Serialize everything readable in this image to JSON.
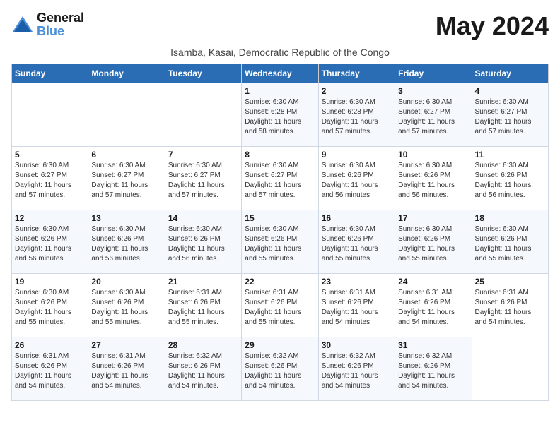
{
  "header": {
    "logo_general": "General",
    "logo_blue": "Blue",
    "month_title": "May 2024",
    "subtitle": "Isamba, Kasai, Democratic Republic of the Congo"
  },
  "calendar": {
    "days_of_week": [
      "Sunday",
      "Monday",
      "Tuesday",
      "Wednesday",
      "Thursday",
      "Friday",
      "Saturday"
    ],
    "weeks": [
      [
        {
          "day": "",
          "info": ""
        },
        {
          "day": "",
          "info": ""
        },
        {
          "day": "",
          "info": ""
        },
        {
          "day": "1",
          "info": "Sunrise: 6:30 AM\nSunset: 6:28 PM\nDaylight: 11 hours\nand 58 minutes."
        },
        {
          "day": "2",
          "info": "Sunrise: 6:30 AM\nSunset: 6:28 PM\nDaylight: 11 hours\nand 57 minutes."
        },
        {
          "day": "3",
          "info": "Sunrise: 6:30 AM\nSunset: 6:27 PM\nDaylight: 11 hours\nand 57 minutes."
        },
        {
          "day": "4",
          "info": "Sunrise: 6:30 AM\nSunset: 6:27 PM\nDaylight: 11 hours\nand 57 minutes."
        }
      ],
      [
        {
          "day": "5",
          "info": "Sunrise: 6:30 AM\nSunset: 6:27 PM\nDaylight: 11 hours\nand 57 minutes."
        },
        {
          "day": "6",
          "info": "Sunrise: 6:30 AM\nSunset: 6:27 PM\nDaylight: 11 hours\nand 57 minutes."
        },
        {
          "day": "7",
          "info": "Sunrise: 6:30 AM\nSunset: 6:27 PM\nDaylight: 11 hours\nand 57 minutes."
        },
        {
          "day": "8",
          "info": "Sunrise: 6:30 AM\nSunset: 6:27 PM\nDaylight: 11 hours\nand 57 minutes."
        },
        {
          "day": "9",
          "info": "Sunrise: 6:30 AM\nSunset: 6:26 PM\nDaylight: 11 hours\nand 56 minutes."
        },
        {
          "day": "10",
          "info": "Sunrise: 6:30 AM\nSunset: 6:26 PM\nDaylight: 11 hours\nand 56 minutes."
        },
        {
          "day": "11",
          "info": "Sunrise: 6:30 AM\nSunset: 6:26 PM\nDaylight: 11 hours\nand 56 minutes."
        }
      ],
      [
        {
          "day": "12",
          "info": "Sunrise: 6:30 AM\nSunset: 6:26 PM\nDaylight: 11 hours\nand 56 minutes."
        },
        {
          "day": "13",
          "info": "Sunrise: 6:30 AM\nSunset: 6:26 PM\nDaylight: 11 hours\nand 56 minutes."
        },
        {
          "day": "14",
          "info": "Sunrise: 6:30 AM\nSunset: 6:26 PM\nDaylight: 11 hours\nand 56 minutes."
        },
        {
          "day": "15",
          "info": "Sunrise: 6:30 AM\nSunset: 6:26 PM\nDaylight: 11 hours\nand 55 minutes."
        },
        {
          "day": "16",
          "info": "Sunrise: 6:30 AM\nSunset: 6:26 PM\nDaylight: 11 hours\nand 55 minutes."
        },
        {
          "day": "17",
          "info": "Sunrise: 6:30 AM\nSunset: 6:26 PM\nDaylight: 11 hours\nand 55 minutes."
        },
        {
          "day": "18",
          "info": "Sunrise: 6:30 AM\nSunset: 6:26 PM\nDaylight: 11 hours\nand 55 minutes."
        }
      ],
      [
        {
          "day": "19",
          "info": "Sunrise: 6:30 AM\nSunset: 6:26 PM\nDaylight: 11 hours\nand 55 minutes."
        },
        {
          "day": "20",
          "info": "Sunrise: 6:30 AM\nSunset: 6:26 PM\nDaylight: 11 hours\nand 55 minutes."
        },
        {
          "day": "21",
          "info": "Sunrise: 6:31 AM\nSunset: 6:26 PM\nDaylight: 11 hours\nand 55 minutes."
        },
        {
          "day": "22",
          "info": "Sunrise: 6:31 AM\nSunset: 6:26 PM\nDaylight: 11 hours\nand 55 minutes."
        },
        {
          "day": "23",
          "info": "Sunrise: 6:31 AM\nSunset: 6:26 PM\nDaylight: 11 hours\nand 54 minutes."
        },
        {
          "day": "24",
          "info": "Sunrise: 6:31 AM\nSunset: 6:26 PM\nDaylight: 11 hours\nand 54 minutes."
        },
        {
          "day": "25",
          "info": "Sunrise: 6:31 AM\nSunset: 6:26 PM\nDaylight: 11 hours\nand 54 minutes."
        }
      ],
      [
        {
          "day": "26",
          "info": "Sunrise: 6:31 AM\nSunset: 6:26 PM\nDaylight: 11 hours\nand 54 minutes."
        },
        {
          "day": "27",
          "info": "Sunrise: 6:31 AM\nSunset: 6:26 PM\nDaylight: 11 hours\nand 54 minutes."
        },
        {
          "day": "28",
          "info": "Sunrise: 6:32 AM\nSunset: 6:26 PM\nDaylight: 11 hours\nand 54 minutes."
        },
        {
          "day": "29",
          "info": "Sunrise: 6:32 AM\nSunset: 6:26 PM\nDaylight: 11 hours\nand 54 minutes."
        },
        {
          "day": "30",
          "info": "Sunrise: 6:32 AM\nSunset: 6:26 PM\nDaylight: 11 hours\nand 54 minutes."
        },
        {
          "day": "31",
          "info": "Sunrise: 6:32 AM\nSunset: 6:26 PM\nDaylight: 11 hours\nand 54 minutes."
        },
        {
          "day": "",
          "info": ""
        }
      ]
    ]
  }
}
